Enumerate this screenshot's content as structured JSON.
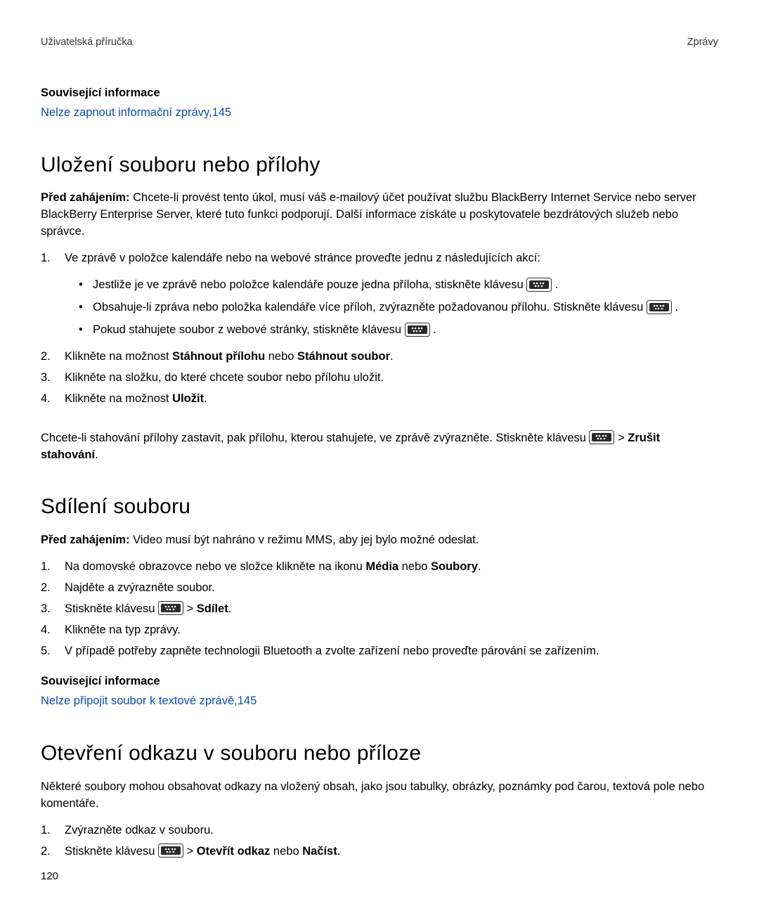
{
  "header": {
    "left": "Uživatelská příručka",
    "right": "Zprávy"
  },
  "related1": {
    "heading": "Související informace",
    "link_text": "Nelze zapnout informační zprávy,",
    "link_page": "145"
  },
  "sec1": {
    "title": "Uložení souboru nebo přílohy",
    "pre_label": "Před zahájením: ",
    "pre_text": "Chcete-li provést tento úkol, musí váš e-mailový účet používat službu BlackBerry Internet Service nebo server BlackBerry Enterprise Server, které tuto funkci podporují. Další informace získáte u poskytovatele bezdrátových služeb nebo správce.",
    "step1_num": "1.",
    "step1_text": "Ve zprávě v položce kalendáře nebo na webové stránce proveďte jednu z následujících akcí:",
    "bullet1_a": "Jestliže je ve zprávě nebo položce kalendáře pouze jedna příloha, stiskněte klávesu ",
    "bullet1_b": " .",
    "bullet2_a": "Obsahuje-li zpráva nebo položka kalendáře více příloh, zvýrazněte požadovanou přílohu. Stiskněte klávesu ",
    "bullet2_b": " .",
    "bullet3_a": "Pokud stahujete soubor z webové stránky, stiskněte klávesu ",
    "bullet3_b": " .",
    "step2_num": "2.",
    "step2_a": "Klikněte na možnost ",
    "step2_b1": "Stáhnout přílohu",
    "step2_c": " nebo ",
    "step2_b2": "Stáhnout soubor",
    "step2_d": ".",
    "step3_num": "3.",
    "step3_text": "Klikněte na složku, do které chcete soubor nebo přílohu uložit.",
    "step4_num": "4.",
    "step4_a": "Klikněte na možnost ",
    "step4_b": "Uložit",
    "step4_c": ".",
    "post_a": "Chcete-li stahování přílohy zastavit, pak přílohu, kterou stahujete, ve zprávě zvýrazněte. Stiskněte klávesu ",
    "post_gt": " > ",
    "post_b": "Zrušit stahování",
    "post_c": "."
  },
  "sec2": {
    "title": "Sdílení souboru",
    "pre_label": "Před zahájením: ",
    "pre_text": "Video musí být nahráno v režimu MMS, aby jej bylo možné odeslat.",
    "step1_num": "1.",
    "step1_a": "Na domovské obrazovce nebo ve složce klikněte na ikonu ",
    "step1_b1": "Média",
    "step1_c": " nebo ",
    "step1_b2": "Soubory",
    "step1_d": ".",
    "step2_num": "2.",
    "step2_text": "Najděte a zvýrazněte soubor.",
    "step3_num": "3.",
    "step3_a": "Stiskněte klávesu ",
    "step3_gt": " > ",
    "step3_b": "Sdílet",
    "step3_c": ".",
    "step4_num": "4.",
    "step4_text": "Klikněte na typ zprávy.",
    "step5_num": "5.",
    "step5_text": "V případě potřeby zapněte technologii Bluetooth a zvolte zařízení nebo proveďte párování se zařízením."
  },
  "related2": {
    "heading": "Související informace",
    "link_text": "Nelze připojit soubor k textové zprávě,",
    "link_page": "145"
  },
  "sec3": {
    "title": "Otevření odkazu v souboru nebo příloze",
    "intro": "Některé soubory mohou obsahovat odkazy na vložený obsah, jako jsou tabulky, obrázky, poznámky pod čarou, textová pole nebo komentáře.",
    "step1_num": "1.",
    "step1_text": "Zvýrazněte odkaz v souboru.",
    "step2_num": "2.",
    "step2_a": "Stiskněte klávesu ",
    "step2_gt": " > ",
    "step2_b1": "Otevřít odkaz",
    "step2_c": " nebo ",
    "step2_b2": "Načíst",
    "step2_d": "."
  },
  "page_number": "120"
}
